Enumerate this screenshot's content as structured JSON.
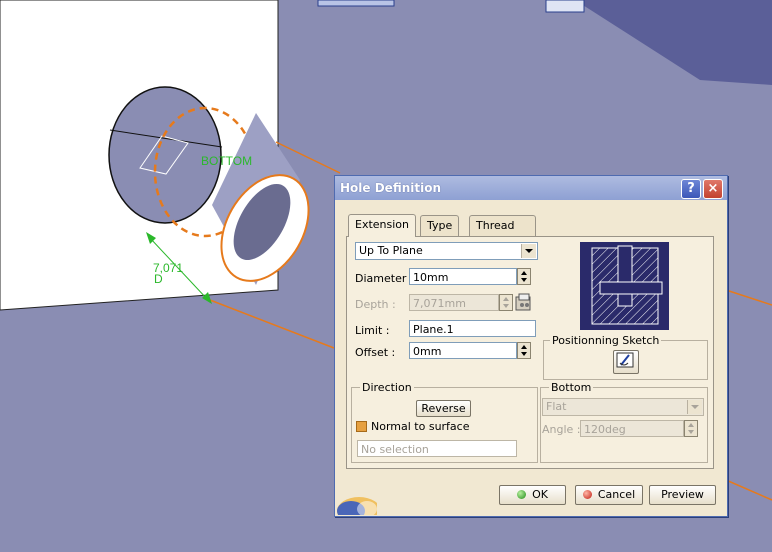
{
  "viewport": {
    "dimension_label": "7,071",
    "dimension_sub": "D",
    "limit_label": "BOTTOM"
  },
  "dialog": {
    "title": "Hole Definition",
    "help_icon": "?",
    "close_icon": "×",
    "tabs": [
      {
        "label": "Extension",
        "active": true
      },
      {
        "label": "Type",
        "active": false
      },
      {
        "label": "Thread Definition",
        "active": false
      }
    ],
    "extension": {
      "limit_type": "Up To Plane",
      "diameter_label": "Diameter :",
      "diameter_value": "10mm",
      "depth_label": "Depth :",
      "depth_value": "7,071mm",
      "limit_label": "Limit :",
      "limit_value": "Plane.1",
      "offset_label": "Offset :",
      "offset_value": "0mm",
      "positioning_sketch_label": "Positionning Sketch",
      "direction": {
        "title": "Direction",
        "reverse_label": "Reverse",
        "normal_label": "Normal to surface",
        "normal_checked": true,
        "selection_value": "No selection"
      },
      "bottom": {
        "title": "Bottom",
        "type_value": "Flat",
        "angle_label": "Angle :",
        "angle_value": "120deg"
      }
    },
    "buttons": {
      "ok": "OK",
      "cancel": "Cancel",
      "preview": "Preview"
    }
  }
}
